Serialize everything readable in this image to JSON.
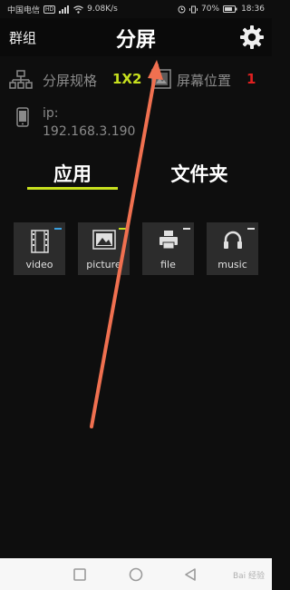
{
  "status_bar": {
    "carrier": "中国电信",
    "hd_badge": "HD",
    "network_speed": "9.08K/s",
    "battery": "70%",
    "time": "18:36"
  },
  "header": {
    "group_label": "群组",
    "title": "分屏"
  },
  "info": {
    "spec_label": "分屏规格",
    "spec_value": "1X2",
    "position_label": "屏幕位置",
    "position_value": "1",
    "ip_label": "ip:",
    "ip_value": "192.168.3.190"
  },
  "tabs": [
    {
      "label": "应用",
      "active": true
    },
    {
      "label": "文件夹",
      "active": false
    }
  ],
  "apps": [
    {
      "label": "video",
      "icon": "film-icon",
      "marker_color": "#3aa0e0"
    },
    {
      "label": "picture",
      "icon": "image-icon",
      "marker_color": "#c7e01e"
    },
    {
      "label": "file",
      "icon": "printer-icon",
      "marker_color": "#e0e0e0"
    },
    {
      "label": "music",
      "icon": "headphones-icon",
      "marker_color": "#e0e0e0"
    }
  ],
  "watermark": "Bai 经验",
  "colors": {
    "accent": "#c7e01e",
    "position_value": "#e02020",
    "arrow": "#f07050"
  }
}
